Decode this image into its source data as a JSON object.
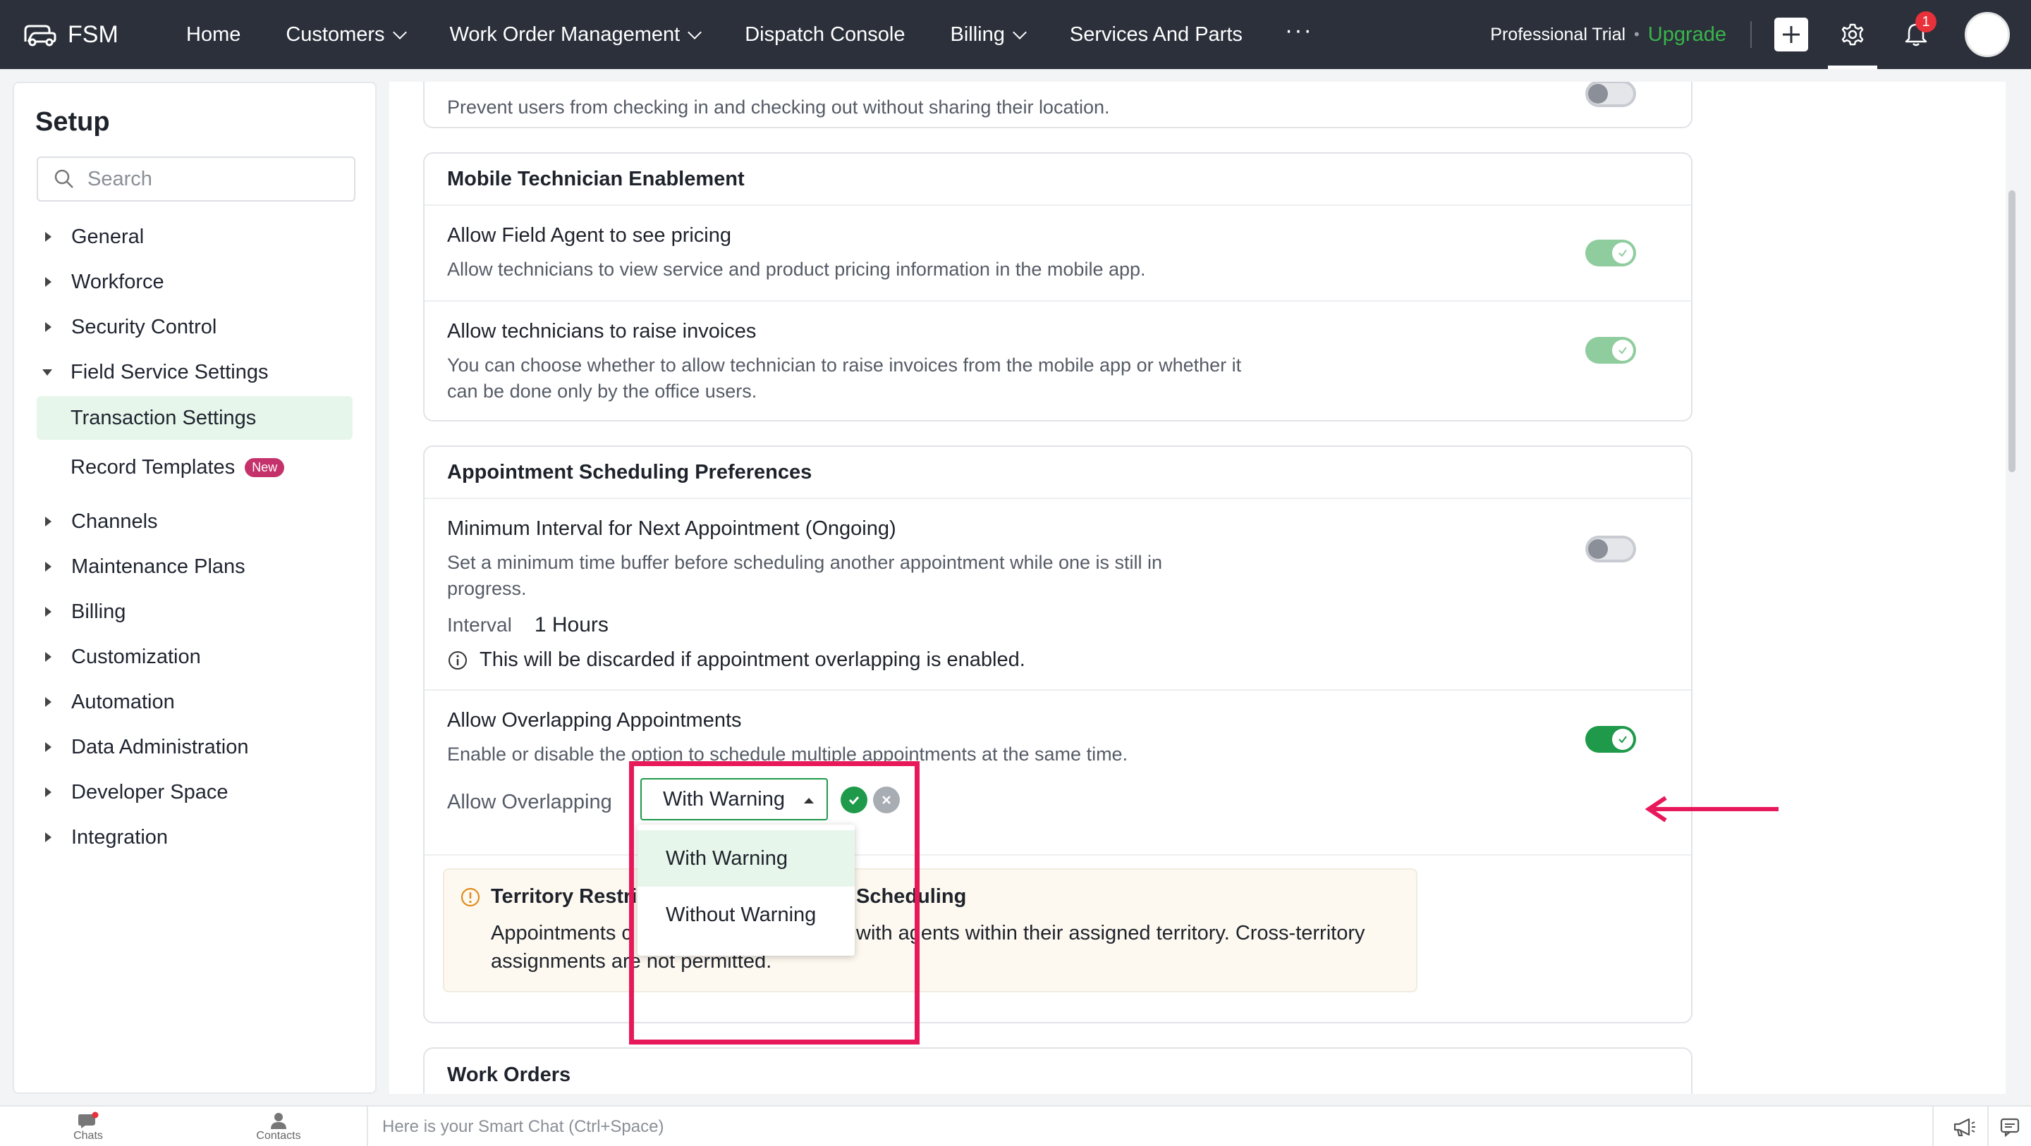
{
  "topnav": {
    "brand": "FSM",
    "items": [
      {
        "label": "Home",
        "has_dropdown": false
      },
      {
        "label": "Customers",
        "has_dropdown": true
      },
      {
        "label": "Work Order Management",
        "has_dropdown": true
      },
      {
        "label": "Dispatch Console",
        "has_dropdown": false
      },
      {
        "label": "Billing",
        "has_dropdown": true
      },
      {
        "label": "Services And Parts",
        "has_dropdown": false
      }
    ],
    "more": "···",
    "trial": "Professional Trial",
    "dot": "•",
    "upgrade": "Upgrade",
    "notification_count": "1"
  },
  "sidebar": {
    "title": "Setup",
    "search_placeholder": "Search",
    "items": [
      {
        "label": "General"
      },
      {
        "label": "Workforce"
      },
      {
        "label": "Security Control"
      },
      {
        "label": "Field Service Settings",
        "expanded": true
      }
    ],
    "sub_items": [
      {
        "label": "Transaction Settings",
        "active": true
      },
      {
        "label": "Record Templates",
        "badge": "New"
      }
    ],
    "items_after": [
      {
        "label": "Channels"
      },
      {
        "label": "Maintenance Plans"
      },
      {
        "label": "Billing"
      },
      {
        "label": "Customization"
      },
      {
        "label": "Automation"
      },
      {
        "label": "Data Administration"
      },
      {
        "label": "Developer Space"
      },
      {
        "label": "Integration"
      }
    ]
  },
  "main": {
    "prev_card": {
      "desc": "Prevent users from checking in and checking out without sharing their location."
    },
    "mobile": {
      "title": "Mobile Technician Enablement",
      "rows": [
        {
          "title": "Allow Field Agent to see pricing",
          "desc": "Allow technicians to view service and product pricing information in the mobile app.",
          "enabled": true
        },
        {
          "title": "Allow technicians to raise invoices",
          "desc1": "You can choose whether to allow technician to raise invoices from the mobile app or whether it",
          "desc2": "can be done only by the office users.",
          "enabled": true
        }
      ]
    },
    "appointment": {
      "title": "Appointment Scheduling Preferences",
      "min_interval": {
        "title": "Minimum Interval for Next Appointment (Ongoing)",
        "desc1": "Set a minimum time buffer before scheduling another appointment while one is still in",
        "desc2": "progress.",
        "interval_label": "Interval",
        "interval_value": "1 Hours",
        "note": "This will be discarded if appointment overlapping is enabled.",
        "enabled": false
      },
      "overlap": {
        "title": "Allow Overlapping Appointments",
        "desc": "Enable or disable the option to schedule multiple appointments at the same time.",
        "field_label": "Allow Overlapping",
        "selected": "With Warning",
        "options": [
          "With Warning",
          "Without Warning"
        ],
        "enabled": true
      },
      "territory": {
        "title_left": "Territory Restri",
        "title_right": "Scheduling",
        "text_left": "Appointments c",
        "text_right": "with agents within their assigned territory. Cross-territory",
        "text2": "assignments are not permitted."
      }
    },
    "work_orders": {
      "title": "Work Orders"
    }
  },
  "bottombar": {
    "chats": "Chats",
    "contacts": "Contacts",
    "smart_chat": "Here is your Smart Chat (Ctrl+Space)"
  },
  "colors": {
    "topnav_bg": "#2b303b",
    "accent_green": "#1e9a4a",
    "upgrade_green": "#39b54a",
    "highlight_pink": "#e8195a",
    "active_bg": "#e7f6ea"
  }
}
